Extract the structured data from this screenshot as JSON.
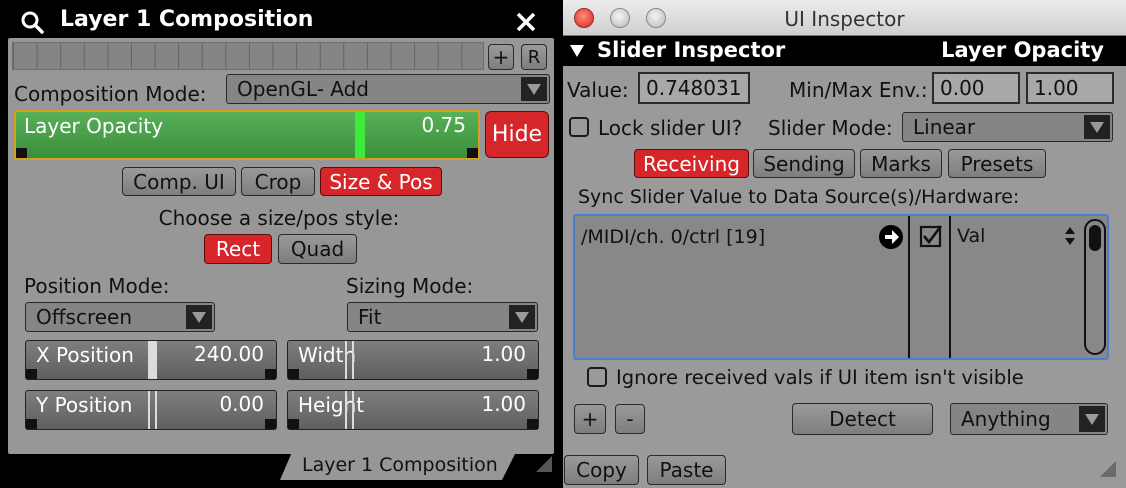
{
  "left_panel": {
    "title": "Layer 1 Composition",
    "top_buttons": {
      "plus": "+",
      "reset": "R"
    },
    "composition_mode_label": "Composition Mode:",
    "composition_mode_value": "OpenGL- Add",
    "opacity_slider": {
      "label": "Layer Opacity",
      "value": "0.75",
      "fill_fraction": 0.75
    },
    "hide_button": "Hide",
    "tabs": [
      "Comp. UI",
      "Crop",
      "Size & Pos"
    ],
    "active_tab": "Size & Pos",
    "style_prompt": "Choose a size/pos style:",
    "style_buttons": [
      "Rect",
      "Quad"
    ],
    "position_mode_label": "Position Mode:",
    "position_mode_value": "Offscreen",
    "sizing_mode_label": "Sizing Mode:",
    "sizing_mode_value": "Fit",
    "x_position": {
      "label": "X Position",
      "value": "240.00"
    },
    "y_position": {
      "label": "Y Position",
      "value": "0.00"
    },
    "width": {
      "label": "Width",
      "value": "1.00"
    },
    "height": {
      "label": "Height",
      "value": "1.00"
    },
    "footer_tab": "Layer 1 Composition"
  },
  "right_panel": {
    "window_title": "UI Inspector",
    "inspector_title": "Slider Inspector",
    "inspected_item": "Layer Opacity",
    "value_label": "Value:",
    "value": "0.748031",
    "minmax_label": "Min/Max Env.:",
    "min": "0.00",
    "max": "1.00",
    "lock_label": "Lock slider UI?",
    "slider_mode_label": "Slider Mode:",
    "slider_mode_value": "Linear",
    "tabs": [
      "Receiving",
      "Sending",
      "Marks",
      "Presets"
    ],
    "active_tab": "Receiving",
    "sync_label": "Sync Slider Value to Data Source(s)/Hardware:",
    "sources": [
      {
        "address": "/MIDI/ch. 0/ctrl [19]",
        "checked": true,
        "mode": "Val"
      }
    ],
    "ignore_label": "Ignore received vals if UI item isn't visible",
    "add_button": "+",
    "remove_button": "-",
    "detect_button": "Detect",
    "detect_type": "Anything",
    "copy_button": "Copy",
    "paste_button": "Paste"
  },
  "colors": {
    "accent_red": "#d7262a",
    "slider_green": "#4fa84f",
    "selection_blue": "#4a7fd0"
  }
}
